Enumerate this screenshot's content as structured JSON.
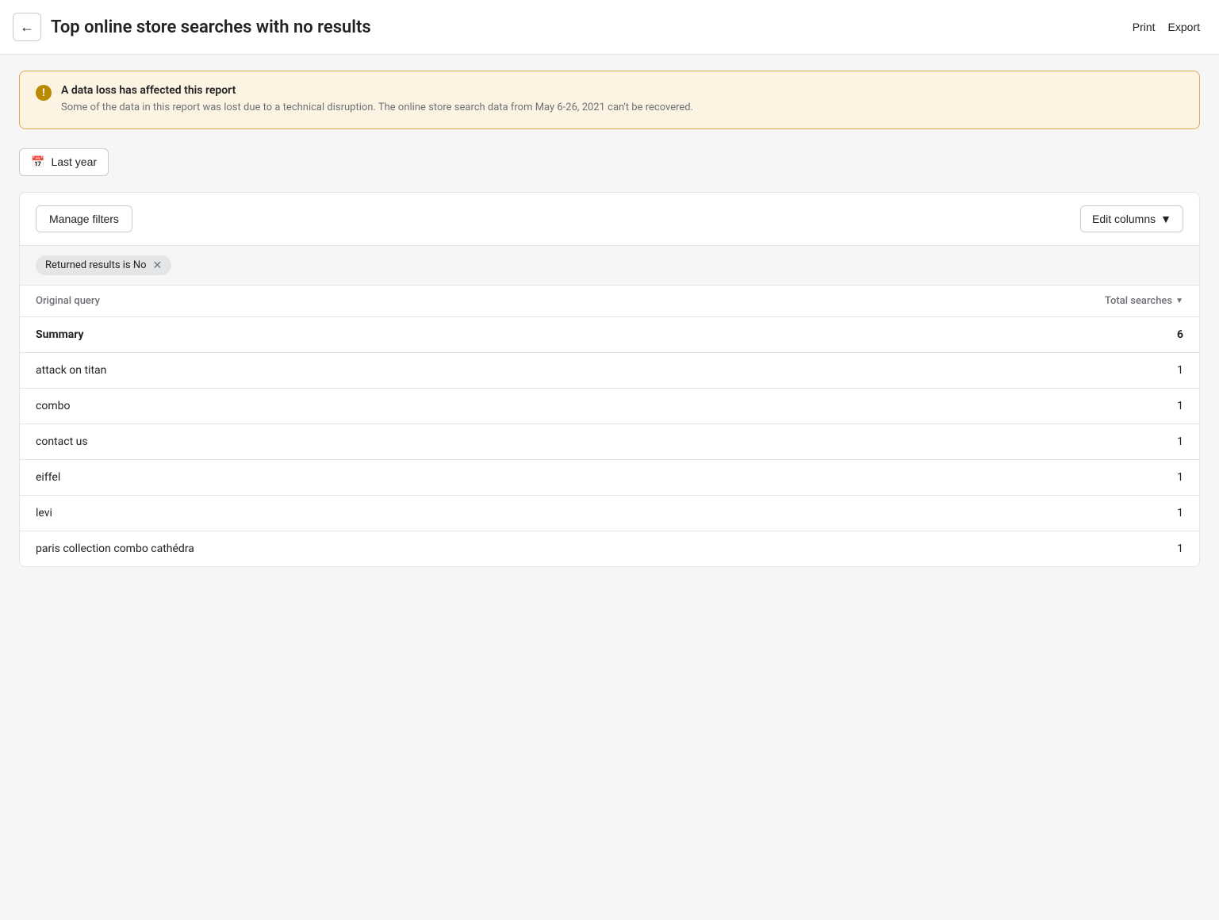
{
  "header": {
    "title": "Top online store searches with no results",
    "back_label": "←",
    "print_label": "Print",
    "export_label": "Export"
  },
  "alert": {
    "title": "A data loss has affected this report",
    "body": "Some of the data in this report was lost due to a technical disruption. The online store search data from May 6-26, 2021 can't be recovered."
  },
  "date_filter": {
    "label": "Last year"
  },
  "toolbar": {
    "manage_filters_label": "Manage filters",
    "edit_columns_label": "Edit columns"
  },
  "active_filters": [
    {
      "label": "Returned results is No"
    }
  ],
  "table": {
    "columns": [
      {
        "label": "Original query",
        "align": "left"
      },
      {
        "label": "Total searches",
        "align": "right",
        "sortable": true
      }
    ],
    "summary": {
      "label": "Summary",
      "total": "6"
    },
    "rows": [
      {
        "query": "attack on titan",
        "count": "1"
      },
      {
        "query": "combo",
        "count": "1"
      },
      {
        "query": "contact us",
        "count": "1"
      },
      {
        "query": "eiffel",
        "count": "1"
      },
      {
        "query": "levi",
        "count": "1"
      },
      {
        "query": "paris collection combo cathédra",
        "count": "1"
      }
    ]
  }
}
